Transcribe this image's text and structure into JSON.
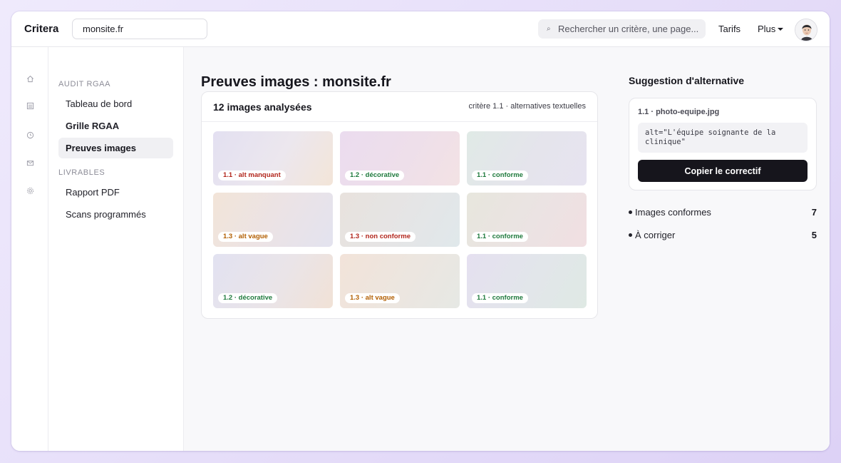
{
  "header": {
    "brand": "Critera",
    "site_value": "monsite.fr",
    "search_placeholder": "Rechercher un critère, une page...",
    "search_icon": "search-icon",
    "nav_tarifs": "Tarifs",
    "nav_plus": "Plus"
  },
  "rail": {
    "icons": [
      "home-icon",
      "list-icon",
      "clock-icon",
      "mail-icon",
      "gear-icon"
    ]
  },
  "sidebar": {
    "section_audit": "AUDIT RGAA",
    "items_audit": [
      {
        "label": "Tableau de bord"
      },
      {
        "label": "Grille RGAA"
      },
      {
        "label": "Preuves images"
      }
    ],
    "section_livrables": "LIVRABLES",
    "items_livrables": [
      {
        "label": "Rapport PDF"
      },
      {
        "label": "Scans programmés"
      }
    ]
  },
  "main": {
    "title": "Preuves images : monsite.fr",
    "panel_title": "12 images analysées",
    "panel_meta": "critère 1.1 · alternatives textuelles",
    "images": [
      {
        "tag": "1.1 · alt manquant",
        "status": "red"
      },
      {
        "tag": "1.2 · décorative",
        "status": "green"
      },
      {
        "tag": "1.1 · conforme",
        "status": "green"
      },
      {
        "tag": "1.3 · alt vague",
        "status": "orange"
      },
      {
        "tag": "1.3 · non conforme",
        "status": "red"
      },
      {
        "tag": "1.1 · conforme",
        "status": "green"
      },
      {
        "tag": "1.2 · décorative",
        "status": "green"
      },
      {
        "tag": "1.3 · alt vague",
        "status": "orange"
      },
      {
        "tag": "1.1 · conforme",
        "status": "green"
      }
    ]
  },
  "suggestion": {
    "title": "Suggestion d'alternative",
    "file": "1.1 · photo-equipe.jpg",
    "code": "alt=\"L'équipe soignante de la clinique\"",
    "copy_label": "Copier le correctif"
  },
  "stats": [
    {
      "label": "Images conformes",
      "value": "7"
    },
    {
      "label": "À corriger",
      "value": "5"
    }
  ],
  "colors": {
    "accent_dark": "#16151c",
    "status_red": "#b2261c",
    "status_green": "#1f7a3d",
    "status_orange": "#b25e00"
  }
}
